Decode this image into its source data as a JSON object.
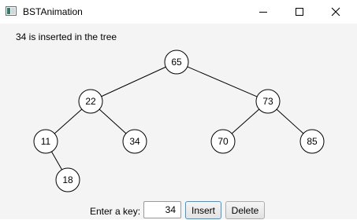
{
  "window": {
    "title": "BSTAnimation"
  },
  "status": "34 is inserted in the tree",
  "tree": {
    "nodes": [
      {
        "id": "65",
        "label": "65"
      },
      {
        "id": "22",
        "label": "22"
      },
      {
        "id": "73",
        "label": "73"
      },
      {
        "id": "11",
        "label": "11"
      },
      {
        "id": "34",
        "label": "34"
      },
      {
        "id": "70",
        "label": "70"
      },
      {
        "id": "85",
        "label": "85"
      },
      {
        "id": "18",
        "label": "18"
      }
    ],
    "edges": [
      [
        "65",
        "22"
      ],
      [
        "65",
        "73"
      ],
      [
        "22",
        "11"
      ],
      [
        "22",
        "34"
      ],
      [
        "73",
        "70"
      ],
      [
        "73",
        "85"
      ],
      [
        "11",
        "18"
      ]
    ]
  },
  "controls": {
    "key_label": "Enter a key:",
    "key_value": "34",
    "insert_label": "Insert",
    "delete_label": "Delete"
  }
}
